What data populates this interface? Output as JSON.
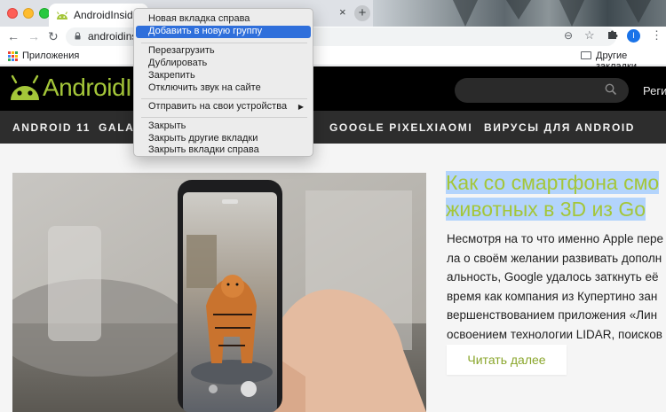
{
  "browser": {
    "active_tab_title": "AndroidInsider.ru",
    "inactive_tab_title": "m",
    "url": "androidinsi",
    "new_tab_symbol": "+",
    "profile_initial": "I"
  },
  "bookmarks": {
    "apps_label": "Приложения",
    "other_label": "Другие закладки"
  },
  "context_menu": {
    "items": [
      "Новая вкладка справа",
      "Добавить в новую группу",
      "Перезагрузить",
      "Дублировать",
      "Закрепить",
      "Отключить звук на сайте",
      "Отправить на свои устройства",
      "Закрыть",
      "Закрыть другие вкладки",
      "Закрыть вкладки справа"
    ]
  },
  "site": {
    "logo_text": "AndroidI",
    "search_placeholder": "",
    "login_label": "Реги",
    "nav": [
      "ANDROID 11",
      "GALAX",
      "GOOGLE PIXEL",
      "XIAOMI",
      "ВИРУСЫ ДЛЯ ANDROID"
    ]
  },
  "article": {
    "title_lines": [
      "Как со смартфона смо",
      "животных в 3D из Go"
    ],
    "excerpt_lines": [
      "Несмотря на то что именно Apple пере",
      "ла о своём желании развивать дополн",
      "альность, Google удалось заткнуть её",
      "время как компания из Купертино зан",
      "вершенствованием приложения «Лин",
      "освоением технологии LIDAR, поисков"
    ],
    "read_more_label": "Читать далее"
  },
  "colors": {
    "brand_green": "#a4c639",
    "menu_highlight": "#2f6fdb",
    "selection": "#b3d4fc"
  }
}
